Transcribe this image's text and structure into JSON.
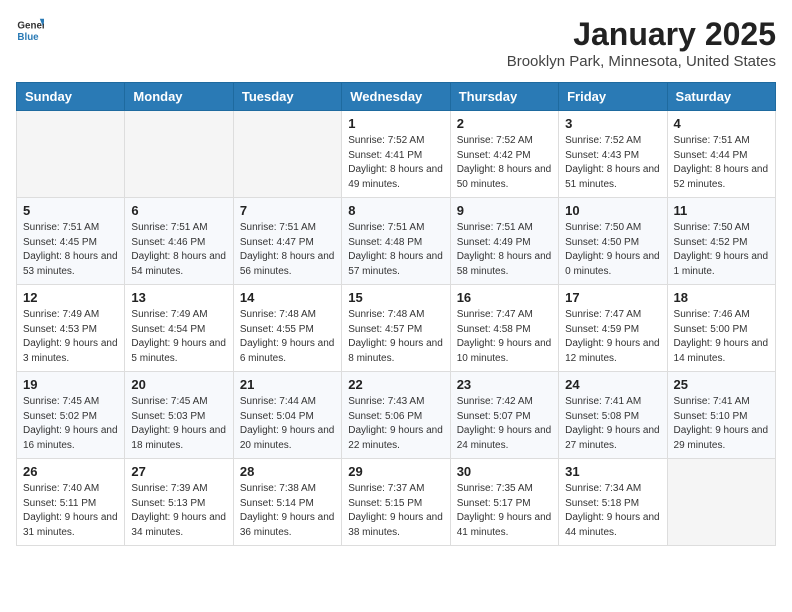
{
  "header": {
    "logo_line1": "General",
    "logo_line2": "Blue",
    "title": "January 2025",
    "subtitle": "Brooklyn Park, Minnesota, United States"
  },
  "days_of_week": [
    "Sunday",
    "Monday",
    "Tuesday",
    "Wednesday",
    "Thursday",
    "Friday",
    "Saturday"
  ],
  "weeks": [
    [
      {
        "day": "",
        "info": ""
      },
      {
        "day": "",
        "info": ""
      },
      {
        "day": "",
        "info": ""
      },
      {
        "day": "1",
        "info": "Sunrise: 7:52 AM\nSunset: 4:41 PM\nDaylight: 8 hours and 49 minutes."
      },
      {
        "day": "2",
        "info": "Sunrise: 7:52 AM\nSunset: 4:42 PM\nDaylight: 8 hours and 50 minutes."
      },
      {
        "day": "3",
        "info": "Sunrise: 7:52 AM\nSunset: 4:43 PM\nDaylight: 8 hours and 51 minutes."
      },
      {
        "day": "4",
        "info": "Sunrise: 7:51 AM\nSunset: 4:44 PM\nDaylight: 8 hours and 52 minutes."
      }
    ],
    [
      {
        "day": "5",
        "info": "Sunrise: 7:51 AM\nSunset: 4:45 PM\nDaylight: 8 hours and 53 minutes."
      },
      {
        "day": "6",
        "info": "Sunrise: 7:51 AM\nSunset: 4:46 PM\nDaylight: 8 hours and 54 minutes."
      },
      {
        "day": "7",
        "info": "Sunrise: 7:51 AM\nSunset: 4:47 PM\nDaylight: 8 hours and 56 minutes."
      },
      {
        "day": "8",
        "info": "Sunrise: 7:51 AM\nSunset: 4:48 PM\nDaylight: 8 hours and 57 minutes."
      },
      {
        "day": "9",
        "info": "Sunrise: 7:51 AM\nSunset: 4:49 PM\nDaylight: 8 hours and 58 minutes."
      },
      {
        "day": "10",
        "info": "Sunrise: 7:50 AM\nSunset: 4:50 PM\nDaylight: 9 hours and 0 minutes."
      },
      {
        "day": "11",
        "info": "Sunrise: 7:50 AM\nSunset: 4:52 PM\nDaylight: 9 hours and 1 minute."
      }
    ],
    [
      {
        "day": "12",
        "info": "Sunrise: 7:49 AM\nSunset: 4:53 PM\nDaylight: 9 hours and 3 minutes."
      },
      {
        "day": "13",
        "info": "Sunrise: 7:49 AM\nSunset: 4:54 PM\nDaylight: 9 hours and 5 minutes."
      },
      {
        "day": "14",
        "info": "Sunrise: 7:48 AM\nSunset: 4:55 PM\nDaylight: 9 hours and 6 minutes."
      },
      {
        "day": "15",
        "info": "Sunrise: 7:48 AM\nSunset: 4:57 PM\nDaylight: 9 hours and 8 minutes."
      },
      {
        "day": "16",
        "info": "Sunrise: 7:47 AM\nSunset: 4:58 PM\nDaylight: 9 hours and 10 minutes."
      },
      {
        "day": "17",
        "info": "Sunrise: 7:47 AM\nSunset: 4:59 PM\nDaylight: 9 hours and 12 minutes."
      },
      {
        "day": "18",
        "info": "Sunrise: 7:46 AM\nSunset: 5:00 PM\nDaylight: 9 hours and 14 minutes."
      }
    ],
    [
      {
        "day": "19",
        "info": "Sunrise: 7:45 AM\nSunset: 5:02 PM\nDaylight: 9 hours and 16 minutes."
      },
      {
        "day": "20",
        "info": "Sunrise: 7:45 AM\nSunset: 5:03 PM\nDaylight: 9 hours and 18 minutes."
      },
      {
        "day": "21",
        "info": "Sunrise: 7:44 AM\nSunset: 5:04 PM\nDaylight: 9 hours and 20 minutes."
      },
      {
        "day": "22",
        "info": "Sunrise: 7:43 AM\nSunset: 5:06 PM\nDaylight: 9 hours and 22 minutes."
      },
      {
        "day": "23",
        "info": "Sunrise: 7:42 AM\nSunset: 5:07 PM\nDaylight: 9 hours and 24 minutes."
      },
      {
        "day": "24",
        "info": "Sunrise: 7:41 AM\nSunset: 5:08 PM\nDaylight: 9 hours and 27 minutes."
      },
      {
        "day": "25",
        "info": "Sunrise: 7:41 AM\nSunset: 5:10 PM\nDaylight: 9 hours and 29 minutes."
      }
    ],
    [
      {
        "day": "26",
        "info": "Sunrise: 7:40 AM\nSunset: 5:11 PM\nDaylight: 9 hours and 31 minutes."
      },
      {
        "day": "27",
        "info": "Sunrise: 7:39 AM\nSunset: 5:13 PM\nDaylight: 9 hours and 34 minutes."
      },
      {
        "day": "28",
        "info": "Sunrise: 7:38 AM\nSunset: 5:14 PM\nDaylight: 9 hours and 36 minutes."
      },
      {
        "day": "29",
        "info": "Sunrise: 7:37 AM\nSunset: 5:15 PM\nDaylight: 9 hours and 38 minutes."
      },
      {
        "day": "30",
        "info": "Sunrise: 7:35 AM\nSunset: 5:17 PM\nDaylight: 9 hours and 41 minutes."
      },
      {
        "day": "31",
        "info": "Sunrise: 7:34 AM\nSunset: 5:18 PM\nDaylight: 9 hours and 44 minutes."
      },
      {
        "day": "",
        "info": ""
      }
    ]
  ]
}
